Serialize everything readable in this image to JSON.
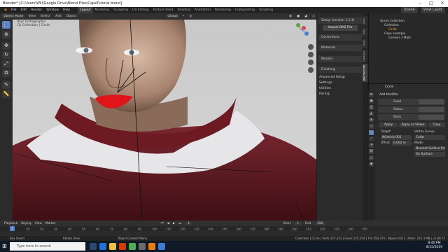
{
  "window": {
    "title": "Blender* [C:\\Users\\Will\\Google Drive\\Blend Files\\CapeTutorial.blend]"
  },
  "menubar": {
    "menus": [
      "File",
      "Edit",
      "Render",
      "Window",
      "Help"
    ],
    "workspaces": [
      "Layout",
      "Modeling",
      "Sculpting",
      "UV Editing",
      "Texture Paint",
      "Shading",
      "Animation",
      "Rendering",
      "Compositing",
      "Scripting"
    ],
    "active_workspace": "Layout",
    "scene_label": "Scene",
    "view_layer_label": "View Layer"
  },
  "viewport_header": {
    "mode": "Object Mode",
    "menus": [
      "View",
      "Select",
      "Add",
      "Object"
    ],
    "orientation": "Global"
  },
  "viewport_info": {
    "line1": "User Orthographic",
    "line2": "(1) Collection | Circle"
  },
  "npanel": {
    "header": "Setup (version 1.3.3)",
    "import_button": "Import DAZ File",
    "sections": [
      "Corrections",
      "Materials",
      "Morphs",
      "Finishing"
    ],
    "lower_sections": [
      "Advanced Setup",
      "Settings",
      "Utilities",
      "Posing"
    ],
    "tabs": [
      "Item",
      "Tool",
      "View",
      "HardOps",
      "DAZ Runtime"
    ]
  },
  "outliner": {
    "header": "Scene Collection",
    "rows": [
      "Scene Collection",
      "Collection",
      "Circle",
      "Cape example",
      "Genesis 3 Male"
    ]
  },
  "properties": {
    "object_name": "Circle",
    "add_modifier": "Add Modifier",
    "modifiers": [
      "Subd",
      "Subsu",
      "Shrin"
    ],
    "apply": "Apply",
    "apply_shape": "Apply as Shape",
    "copy": "Copy",
    "target_label": "Target:",
    "target_value": "NOrtrick.001",
    "offset_label": "Offset:",
    "offset_value": "0.002 m",
    "vertex_group_label": "Vertex Group:",
    "vertex_group_value": "Collar",
    "mode_label": "Mode:",
    "mode_value": "Nearest Surface Point",
    "surface_value": "On Surface"
  },
  "timeline": {
    "menus": [
      "Playback",
      "Keying",
      "View",
      "Marker"
    ],
    "frame_current": "1",
    "start_label": "Start",
    "start_value": "1",
    "end_label": "End",
    "end_value": "250",
    "ticks": [
      "0",
      "10",
      "20",
      "30",
      "40",
      "50",
      "60",
      "70",
      "80",
      "90",
      "100",
      "110",
      "120",
      "130",
      "140",
      "150",
      "160",
      "170",
      "180",
      "190",
      "200",
      "210",
      "220",
      "230",
      "240",
      "250"
    ]
  },
  "statusbar": {
    "left": "Box Select",
    "mid1": "Rotate View",
    "mid2": "Object Context Menu",
    "right": "Collection | Circle | Verts:127,352 | Faces:125,354 | Tris:250,374 | Objects:0/11 | Mem: 252.3 MB | v2.80.75"
  },
  "taskbar": {
    "search_placeholder": "Type here to search",
    "time": "8:40 PM",
    "date": "8/15/2019"
  },
  "colors": {
    "accent": "#5680c2",
    "outfit": "#6b1c22",
    "lips": "#e0151a"
  }
}
